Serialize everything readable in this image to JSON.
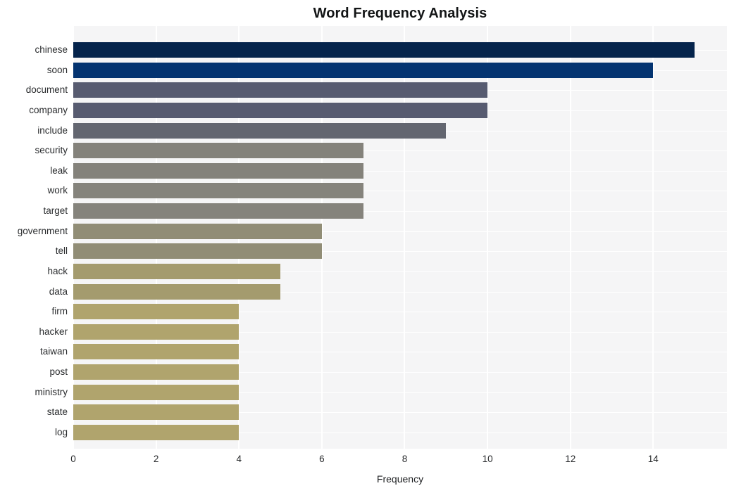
{
  "chart_data": {
    "type": "bar",
    "orientation": "horizontal",
    "title": "Word Frequency Analysis",
    "xlabel": "Frequency",
    "ylabel": "",
    "categories": [
      "chinese",
      "soon",
      "document",
      "company",
      "include",
      "security",
      "leak",
      "work",
      "target",
      "government",
      "tell",
      "hack",
      "data",
      "firm",
      "hacker",
      "taiwan",
      "post",
      "ministry",
      "state",
      "log"
    ],
    "values": [
      15,
      14,
      10,
      10,
      9,
      7,
      7,
      7,
      7,
      6,
      6,
      5,
      5,
      4,
      4,
      4,
      4,
      4,
      4,
      4
    ],
    "bar_colors": [
      "#05244c",
      "#043471",
      "#575b70",
      "#575b70",
      "#636670",
      "#84827b",
      "#84827b",
      "#85837c",
      "#85837c",
      "#918d76",
      "#918d76",
      "#a49b6e",
      "#a49b6e",
      "#b0a46d",
      "#b0a46d",
      "#b0a46d",
      "#b0a46d",
      "#b0a46d",
      "#b0a46d",
      "#b0a46d"
    ],
    "xticks": [
      0,
      2,
      4,
      6,
      8,
      10,
      12,
      14
    ],
    "xlim": [
      0,
      15.78
    ],
    "grid": true,
    "legend": false,
    "plot_background": "#f5f5f6",
    "grid_color": "#ffffff",
    "figure_background": "#ffffff",
    "title_color": "#131516",
    "tick_label_color": "#2a2c2e"
  }
}
